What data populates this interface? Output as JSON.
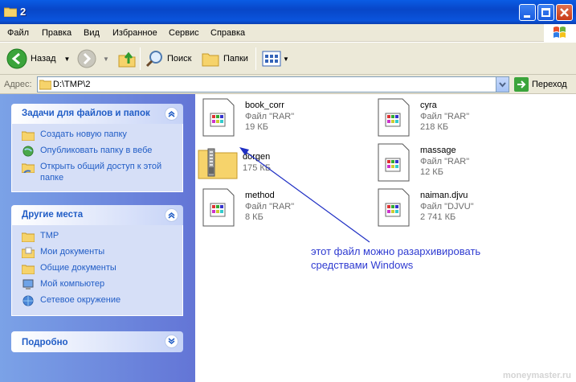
{
  "window": {
    "title": "2"
  },
  "menu": [
    "Файл",
    "Правка",
    "Вид",
    "Избранное",
    "Сервис",
    "Справка"
  ],
  "toolbar": {
    "back": "Назад",
    "search": "Поиск",
    "folders": "Папки"
  },
  "address": {
    "label": "Адрес:",
    "value": "D:\\TMP\\2",
    "go": "Переход"
  },
  "tasks": {
    "title": "Задачи для файлов и папок",
    "items": [
      "Создать новую папку",
      "Опубликовать папку в вебе",
      "Открыть общий доступ к этой папке"
    ]
  },
  "places": {
    "title": "Другие места",
    "items": [
      "TMP",
      "Мои документы",
      "Общие документы",
      "Мой компьютер",
      "Сетевое окружение"
    ]
  },
  "details": {
    "title": "Подробно"
  },
  "files": [
    {
      "name": "book_corr",
      "type": "Файл \"RAR\"",
      "size": "19 КБ",
      "icon": "rar-file-icon"
    },
    {
      "name": "cyra",
      "type": "Файл \"RAR\"",
      "size": "218 КБ",
      "icon": "rar-file-icon"
    },
    {
      "name": "dorgen",
      "type": "",
      "size": "175 КБ",
      "icon": "zip-folder-icon"
    },
    {
      "name": "massage",
      "type": "Файл \"RAR\"",
      "size": "12 КБ",
      "icon": "rar-file-icon"
    },
    {
      "name": "method",
      "type": "Файл \"RAR\"",
      "size": "8 КБ",
      "icon": "rar-file-icon"
    },
    {
      "name": "naiman.djvu",
      "type": "Файл \"DJVU\"",
      "size": "2 741 КБ",
      "icon": "djvu-file-icon"
    }
  ],
  "annotation": {
    "line1": "этот файл можно разархивировать",
    "line2": "средствами Windows"
  },
  "watermark": "moneymaster.ru",
  "colors": {
    "titlebar": "#0a54dc",
    "sidepane": "#7ba2e7",
    "link": "#215dc6",
    "annotation": "#2f3bd1"
  }
}
